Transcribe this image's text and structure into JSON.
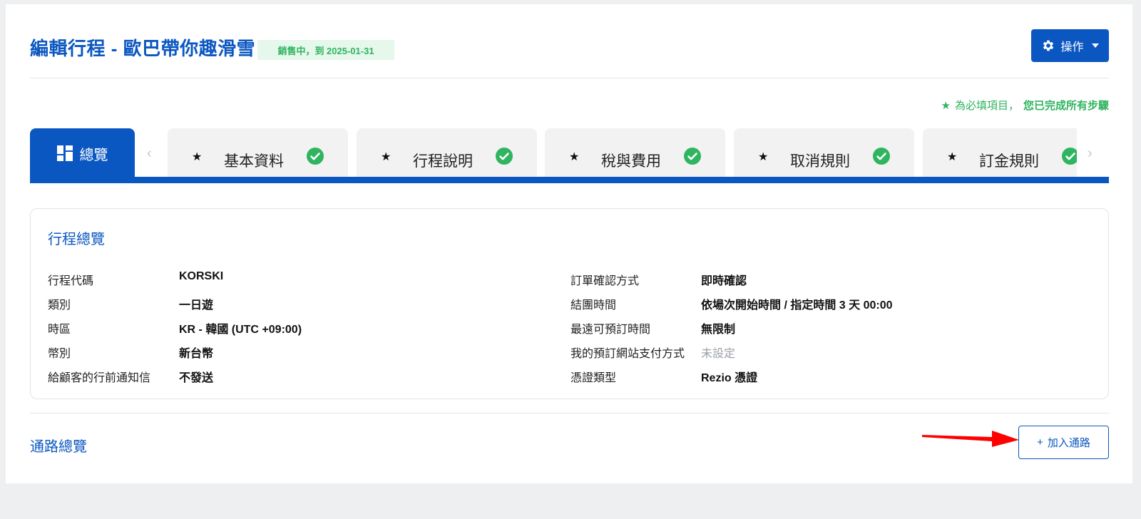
{
  "header": {
    "title": "編輯行程  - 歐巴帶你趣滑雪",
    "status_badge": "銷售中，到 2025-01-31",
    "actions_label": "操作"
  },
  "required_note": {
    "marker": "★",
    "text": "為必填項目，",
    "done_text": "您已完成所有步驟"
  },
  "tabs": {
    "overview_label": "總覽",
    "items": [
      {
        "label": "基本資料",
        "completed": true
      },
      {
        "label": "行程說明",
        "completed": true
      },
      {
        "label": "稅與費用",
        "completed": true
      },
      {
        "label": "取消規則",
        "completed": true
      },
      {
        "label": "訂金規則",
        "completed": true
      }
    ]
  },
  "overview": {
    "title": "行程總覽",
    "left_fields": [
      {
        "label": "行程代碼",
        "value": "KORSKI"
      },
      {
        "label": "類別",
        "value": "一日遊"
      },
      {
        "label": "時區",
        "value": "KR - 韓國 (UTC +09:00)"
      },
      {
        "label": "幣別",
        "value": "新台幣"
      },
      {
        "label": "給顧客的行前通知信",
        "value": "不發送"
      }
    ],
    "right_fields": [
      {
        "label": "訂單確認方式",
        "value": "即時確認"
      },
      {
        "label": "結團時間",
        "value": "依場次開始時間 / 指定時間 3 天 00:00"
      },
      {
        "label": "最遠可預訂時間",
        "value": "無限制"
      },
      {
        "label": "我的預訂網站支付方式",
        "value": "未設定"
      },
      {
        "label": "憑證類型",
        "value": "Rezio 憑證"
      }
    ]
  },
  "channels": {
    "title": "通路總覽",
    "add_button_label": "加入通路"
  },
  "colors": {
    "brand": "#0b57c1",
    "success": "#2fb45f",
    "annotation": "#ff0000"
  },
  "icons": [
    "gear-icon",
    "caret-down-icon",
    "dashboard-icon",
    "star-icon",
    "check-circle-icon",
    "chevron-left-icon",
    "chevron-right-icon",
    "plus-icon"
  ]
}
